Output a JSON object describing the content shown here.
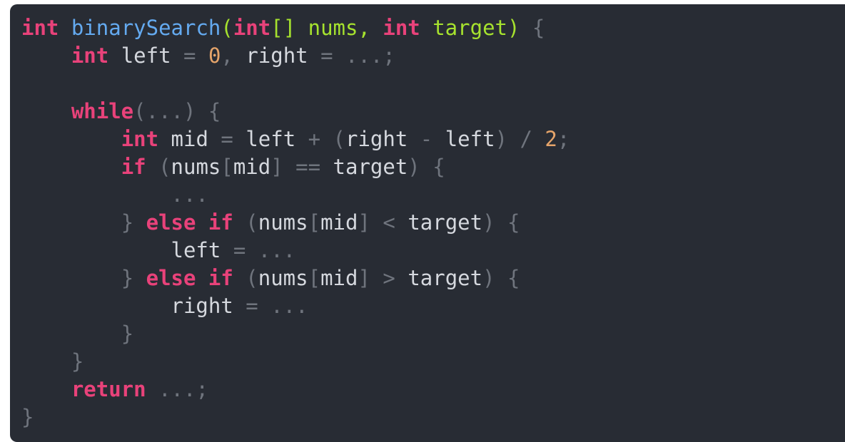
{
  "colors": {
    "background": "#282c34",
    "keyword": "#e8427a",
    "function": "#64aaf0",
    "parameter": "#a6e22e",
    "number": "#e5a46a",
    "punctuation": "#6f747d",
    "identifier": "#d5d8de"
  },
  "code": {
    "lines": [
      [
        {
          "t": "kw",
          "v": "int"
        },
        {
          "t": "id",
          "v": " "
        },
        {
          "t": "fn",
          "v": "binarySearch"
        },
        {
          "t": "param",
          "v": "("
        },
        {
          "t": "kw",
          "v": "int"
        },
        {
          "t": "param",
          "v": "[] nums, "
        },
        {
          "t": "kw",
          "v": "int"
        },
        {
          "t": "param",
          "v": " target)"
        },
        {
          "t": "punct",
          "v": " {"
        }
      ],
      [
        {
          "t": "id",
          "v": "    "
        },
        {
          "t": "kw",
          "v": "int"
        },
        {
          "t": "id",
          "v": " left "
        },
        {
          "t": "punct",
          "v": "="
        },
        {
          "t": "id",
          "v": " "
        },
        {
          "t": "num",
          "v": "0"
        },
        {
          "t": "punct",
          "v": ","
        },
        {
          "t": "id",
          "v": " right "
        },
        {
          "t": "punct",
          "v": "= ...;"
        }
      ],
      [],
      [
        {
          "t": "id",
          "v": "    "
        },
        {
          "t": "kw",
          "v": "while"
        },
        {
          "t": "punct",
          "v": "(...) {"
        }
      ],
      [
        {
          "t": "id",
          "v": "        "
        },
        {
          "t": "kw",
          "v": "int"
        },
        {
          "t": "id",
          "v": " mid "
        },
        {
          "t": "punct",
          "v": "="
        },
        {
          "t": "id",
          "v": " left "
        },
        {
          "t": "punct",
          "v": "+ ("
        },
        {
          "t": "id",
          "v": "right "
        },
        {
          "t": "punct",
          "v": "-"
        },
        {
          "t": "id",
          "v": " left"
        },
        {
          "t": "punct",
          "v": ") / "
        },
        {
          "t": "num",
          "v": "2"
        },
        {
          "t": "punct",
          "v": ";"
        }
      ],
      [
        {
          "t": "id",
          "v": "        "
        },
        {
          "t": "kw",
          "v": "if"
        },
        {
          "t": "punct",
          "v": " ("
        },
        {
          "t": "id",
          "v": "nums"
        },
        {
          "t": "punct",
          "v": "["
        },
        {
          "t": "id",
          "v": "mid"
        },
        {
          "t": "punct",
          "v": "] =="
        },
        {
          "t": "id",
          "v": " target"
        },
        {
          "t": "punct",
          "v": ") {"
        }
      ],
      [
        {
          "t": "id",
          "v": "            "
        },
        {
          "t": "punct",
          "v": "..."
        }
      ],
      [
        {
          "t": "id",
          "v": "        "
        },
        {
          "t": "punct",
          "v": "}"
        },
        {
          "t": "id",
          "v": " "
        },
        {
          "t": "kw",
          "v": "else if"
        },
        {
          "t": "punct",
          "v": " ("
        },
        {
          "t": "id",
          "v": "nums"
        },
        {
          "t": "punct",
          "v": "["
        },
        {
          "t": "id",
          "v": "mid"
        },
        {
          "t": "punct",
          "v": "] <"
        },
        {
          "t": "id",
          "v": " target"
        },
        {
          "t": "punct",
          "v": ") {"
        }
      ],
      [
        {
          "t": "id",
          "v": "            left "
        },
        {
          "t": "punct",
          "v": "= ..."
        }
      ],
      [
        {
          "t": "id",
          "v": "        "
        },
        {
          "t": "punct",
          "v": "}"
        },
        {
          "t": "id",
          "v": " "
        },
        {
          "t": "kw",
          "v": "else if"
        },
        {
          "t": "punct",
          "v": " ("
        },
        {
          "t": "id",
          "v": "nums"
        },
        {
          "t": "punct",
          "v": "["
        },
        {
          "t": "id",
          "v": "mid"
        },
        {
          "t": "punct",
          "v": "] >"
        },
        {
          "t": "id",
          "v": " target"
        },
        {
          "t": "punct",
          "v": ") {"
        }
      ],
      [
        {
          "t": "id",
          "v": "            right "
        },
        {
          "t": "punct",
          "v": "= ..."
        }
      ],
      [
        {
          "t": "id",
          "v": "        "
        },
        {
          "t": "punct",
          "v": "}"
        }
      ],
      [
        {
          "t": "id",
          "v": "    "
        },
        {
          "t": "punct",
          "v": "}"
        }
      ],
      [
        {
          "t": "id",
          "v": "    "
        },
        {
          "t": "kw",
          "v": "return"
        },
        {
          "t": "punct",
          "v": " ...;"
        }
      ],
      [
        {
          "t": "punct",
          "v": "}"
        }
      ]
    ]
  }
}
